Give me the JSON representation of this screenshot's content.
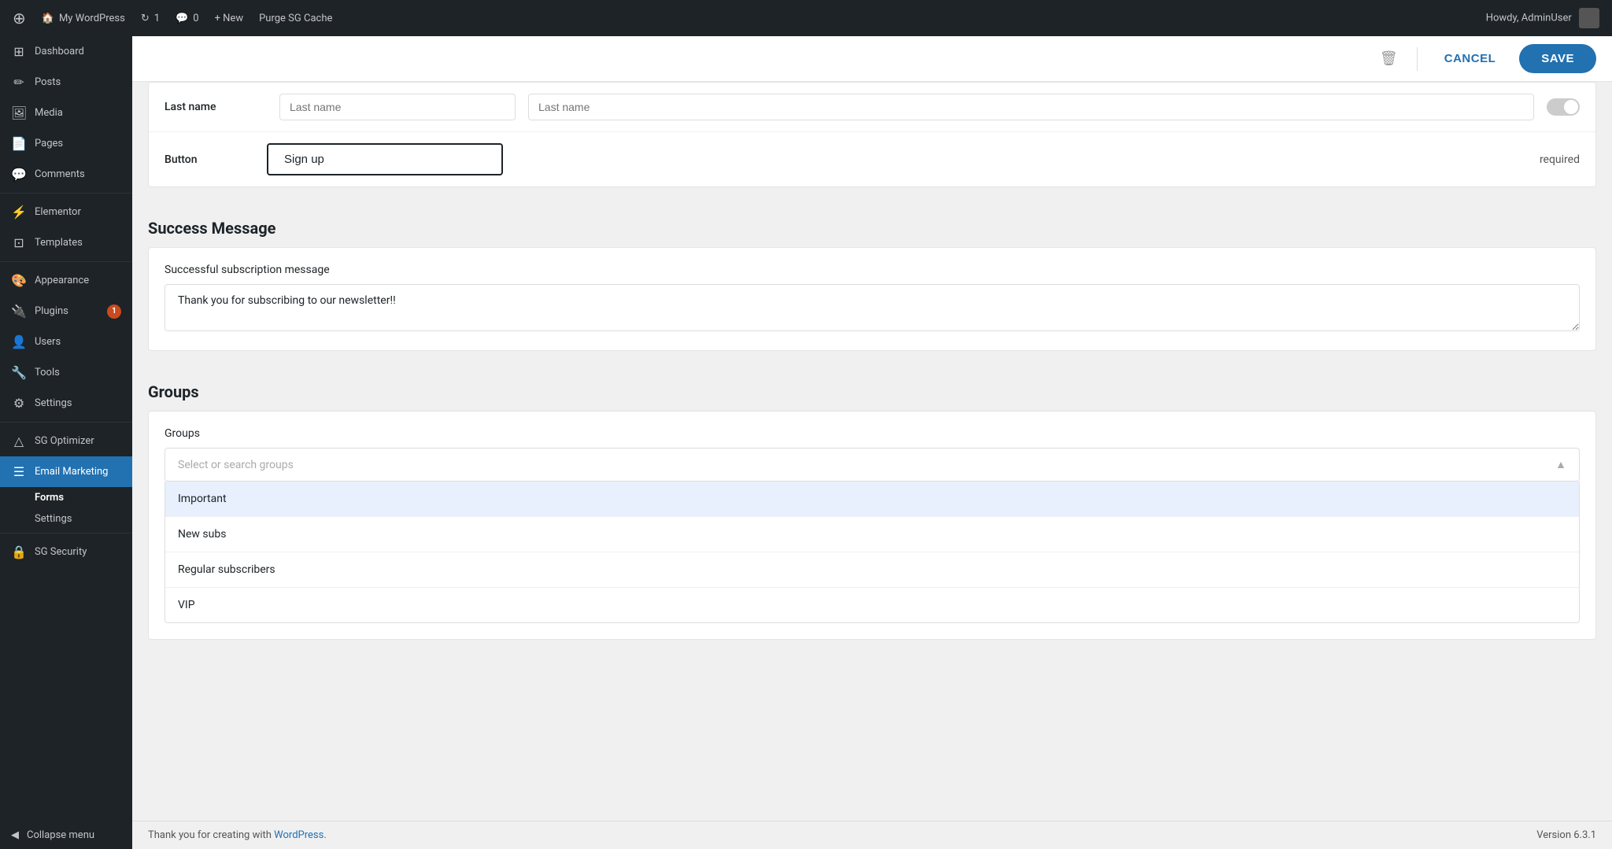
{
  "adminBar": {
    "logo": "⊕",
    "siteName": "My WordPress",
    "updates": "1",
    "comments": "0",
    "newLabel": "+ New",
    "purgeLabel": "Purge SG Cache",
    "userLabel": "Howdy, AdminUser"
  },
  "sidebar": {
    "items": [
      {
        "id": "dashboard",
        "label": "Dashboard",
        "icon": "⊞"
      },
      {
        "id": "posts",
        "label": "Posts",
        "icon": "✏"
      },
      {
        "id": "media",
        "label": "Media",
        "icon": "🖼"
      },
      {
        "id": "pages",
        "label": "Pages",
        "icon": "📄"
      },
      {
        "id": "comments",
        "label": "Comments",
        "icon": "💬"
      },
      {
        "id": "elementor",
        "label": "Elementor",
        "icon": "⚡"
      },
      {
        "id": "templates",
        "label": "Templates",
        "icon": "⊡"
      },
      {
        "id": "appearance",
        "label": "Appearance",
        "icon": "🎨"
      },
      {
        "id": "plugins",
        "label": "Plugins",
        "icon": "🔌",
        "badge": "1"
      },
      {
        "id": "users",
        "label": "Users",
        "icon": "👤"
      },
      {
        "id": "tools",
        "label": "Tools",
        "icon": "🔧"
      },
      {
        "id": "settings",
        "label": "Settings",
        "icon": "⚙"
      },
      {
        "id": "sg-optimizer",
        "label": "SG Optimizer",
        "icon": "△"
      },
      {
        "id": "email-marketing",
        "label": "Email Marketing",
        "icon": "📧",
        "active": true
      }
    ],
    "subItems": [
      {
        "id": "forms",
        "label": "Forms",
        "active": true
      },
      {
        "id": "settings",
        "label": "Settings"
      }
    ],
    "sgSecurity": {
      "label": "SG Security",
      "icon": "🔒"
    },
    "collapseLabel": "Collapse menu"
  },
  "topBar": {
    "cancelLabel": "CANCEL",
    "saveLabel": "SAVE"
  },
  "lastNameRow": {
    "label": "Last name",
    "placeholder1": "Last name",
    "placeholder2": "Last name"
  },
  "buttonRow": {
    "label": "Button",
    "value": "Sign up",
    "requiredLabel": "required"
  },
  "successMessage": {
    "heading": "Success Message",
    "fieldLabel": "Successful subscription message",
    "value": "Thank you for subscribing to our newsletter!!"
  },
  "groups": {
    "heading": "Groups",
    "fieldLabel": "Groups",
    "placeholder": "Select or search groups",
    "options": [
      {
        "id": "important",
        "label": "Important",
        "highlighted": true
      },
      {
        "id": "new-subs",
        "label": "New subs"
      },
      {
        "id": "regular",
        "label": "Regular subscribers"
      },
      {
        "id": "vip",
        "label": "VIP"
      }
    ]
  },
  "footer": {
    "thankYouText": "Thank you for creating with",
    "wordpressLink": "WordPress.",
    "version": "Version 6.3.1"
  }
}
